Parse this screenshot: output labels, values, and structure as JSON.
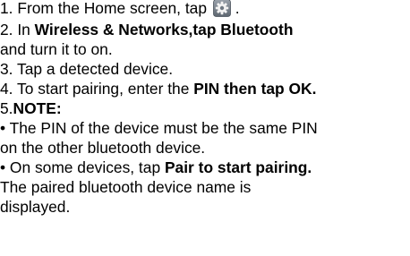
{
  "steps": {
    "s1_text": "1. From the Home screen, tap",
    "s1_after_icon": " .",
    "s1_icon": "settings-gear-icon",
    "s2_prefix": "2. In ",
    "s2_bold": "Wireless & Networks,tap Bluetooth",
    "s2_cont": "and turn it to on.",
    "s3": "3. Tap a detected device.",
    "s4_prefix": "4. To start pairing, enter the ",
    "s4_bold": "PIN then tap OK.",
    "s5_prefix": "5.",
    "s5_bold": "NOTE:"
  },
  "notes": {
    "n1_line1": "•  The PIN of the device must be the same PIN",
    "n1_line2": "on the other bluetooth device.",
    "n2_prefix": "•  On some devices, tap ",
    "n2_bold": "Pair to start pairing.",
    "n2_line2": "The paired bluetooth device name is",
    "n2_line3": "displayed."
  },
  "icon_colors": {
    "tile_top": "#9aa2ab",
    "tile_bottom": "#5d6670",
    "gear": "#f2f2f2"
  }
}
